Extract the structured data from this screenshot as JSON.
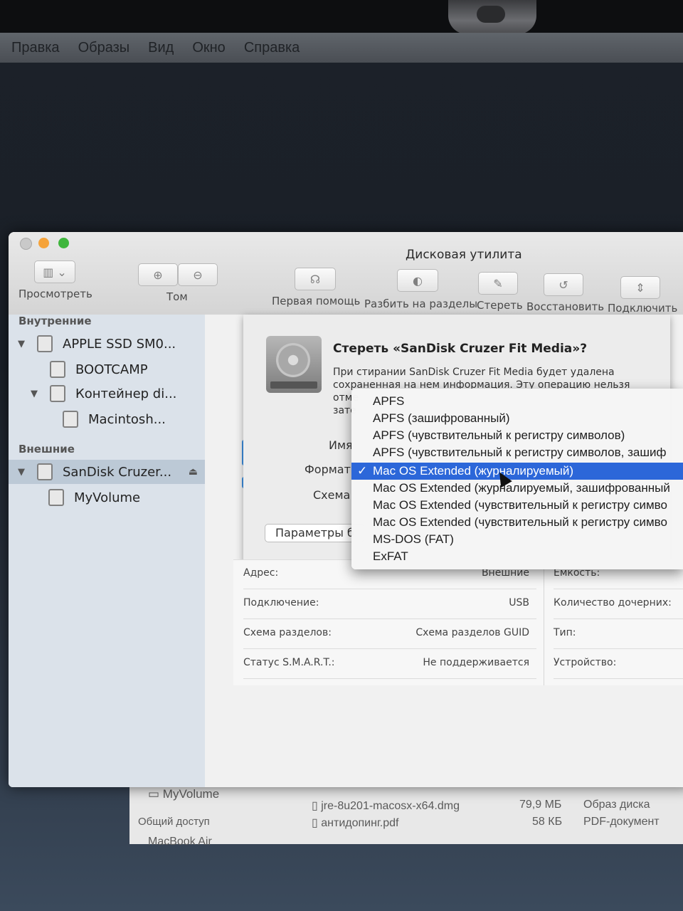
{
  "menubar": [
    "Правка",
    "Образы",
    "Вид",
    "Окно",
    "Справка"
  ],
  "window": {
    "title": "Дисковая утилита",
    "toolbar": {
      "view_label": "Просмотреть",
      "volume_label": "Том",
      "first_aid_label": "Первая помощь",
      "partition_label": "Разбить на разделы",
      "erase_label": "Стереть",
      "restore_label": "Восстановить",
      "mount_label": "Подключить"
    }
  },
  "sidebar": {
    "internal_header": "Внутренние",
    "external_header": "Внешние",
    "items": [
      {
        "label": "APPLE SSD SM0..."
      },
      {
        "label": "BOOTCAMP"
      },
      {
        "label": "Контейнер di..."
      },
      {
        "label": "Macintosh..."
      },
      {
        "label": "SanDisk Cruzer..."
      },
      {
        "label": "MyVolume"
      }
    ]
  },
  "sheet": {
    "title": "Стереть «SanDisk Cruzer Fit Media»?",
    "body": "При стирании SanDisk Cruzer Fit Media будет удалена сохраненная на нем информация. Эту операцию нельзя отме",
    "body_line4": "зате",
    "name_label": "Имя",
    "format_label": "Формат",
    "scheme_label": "Схема",
    "options_button": "Параметры б"
  },
  "format_menu": {
    "options": [
      "APFS",
      "APFS (зашифрованный)",
      "APFS (чувствительный к регистру символов)",
      "APFS (чувствительный к регистру символов, зашиф",
      "Mac OS Extended (журналируемый)",
      "Mac OS Extended (журналируемый, зашифрованный",
      "Mac OS Extended (чувствительный к регистру симво",
      "Mac OS Extended (чувствительный к регистру симво",
      "MS-DOS (FAT)",
      "ExFAT"
    ],
    "selected_index": 4,
    "check": "✓"
  },
  "info": {
    "rows": [
      {
        "key": "Адрес:",
        "value": "Внешние"
      },
      {
        "key": "Подключение:",
        "value": "USB"
      },
      {
        "key": "Схема разделов:",
        "value": "Схема разделов GUID"
      },
      {
        "key": "Статус S.M.A.R.T.:",
        "value": "Не поддерживается"
      }
    ],
    "right_keys": [
      "Емкость:",
      "Количество дочерних:",
      "Тип:",
      "Устройство:"
    ]
  },
  "finder": {
    "sidebar_item": "MyVolume",
    "shared_header": "Общий доступ",
    "mac_item": "MacBook Air",
    "files": [
      {
        "name": "jre-8u201-macosx-x64.dmg",
        "size": "79,9 МБ",
        "kind": "Образ диска"
      },
      {
        "name": "антидопинг.pdf",
        "size": "58 КБ",
        "kind": "PDF-документ"
      }
    ]
  }
}
